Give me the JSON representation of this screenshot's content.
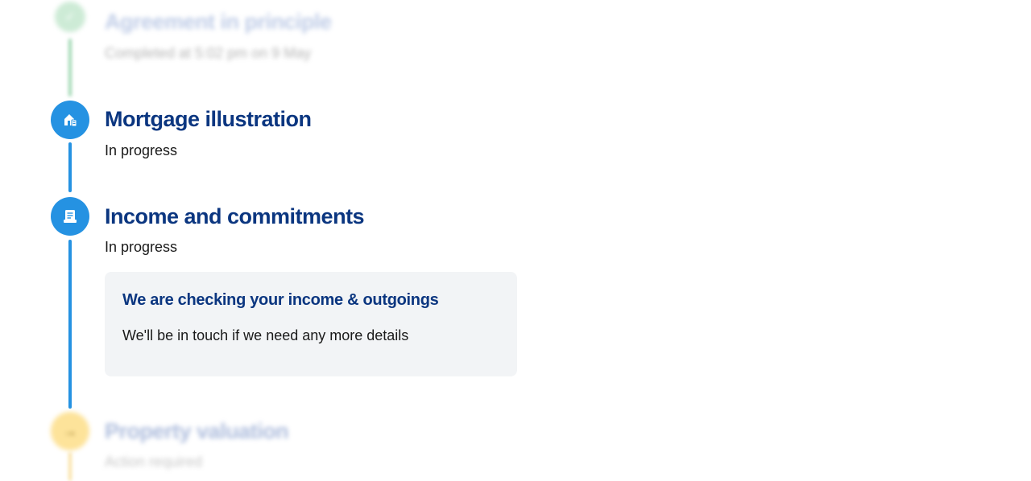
{
  "steps": [
    {
      "title": "Agreement in principle",
      "status": "Completed at 5:02 pm on 9 May",
      "icon": "check-icon",
      "state": "completed"
    },
    {
      "title": "Mortgage illustration",
      "status": "In progress",
      "icon": "house-document-icon",
      "state": "in-progress"
    },
    {
      "title": "Income and commitments",
      "status": "In progress",
      "icon": "document-icon",
      "state": "in-progress",
      "card": {
        "title": "We are checking your income & outgoings",
        "body": "We'll be in touch if we need any more details"
      }
    },
    {
      "title": "Property valuation",
      "status": "Action required",
      "icon": "arrow-right-icon",
      "state": "action-required"
    }
  ],
  "colors": {
    "primary": "#2592e2",
    "heading": "#0b3680",
    "completed": "#7fc99a",
    "action": "#fde39a",
    "card_bg": "#f2f4f6"
  }
}
